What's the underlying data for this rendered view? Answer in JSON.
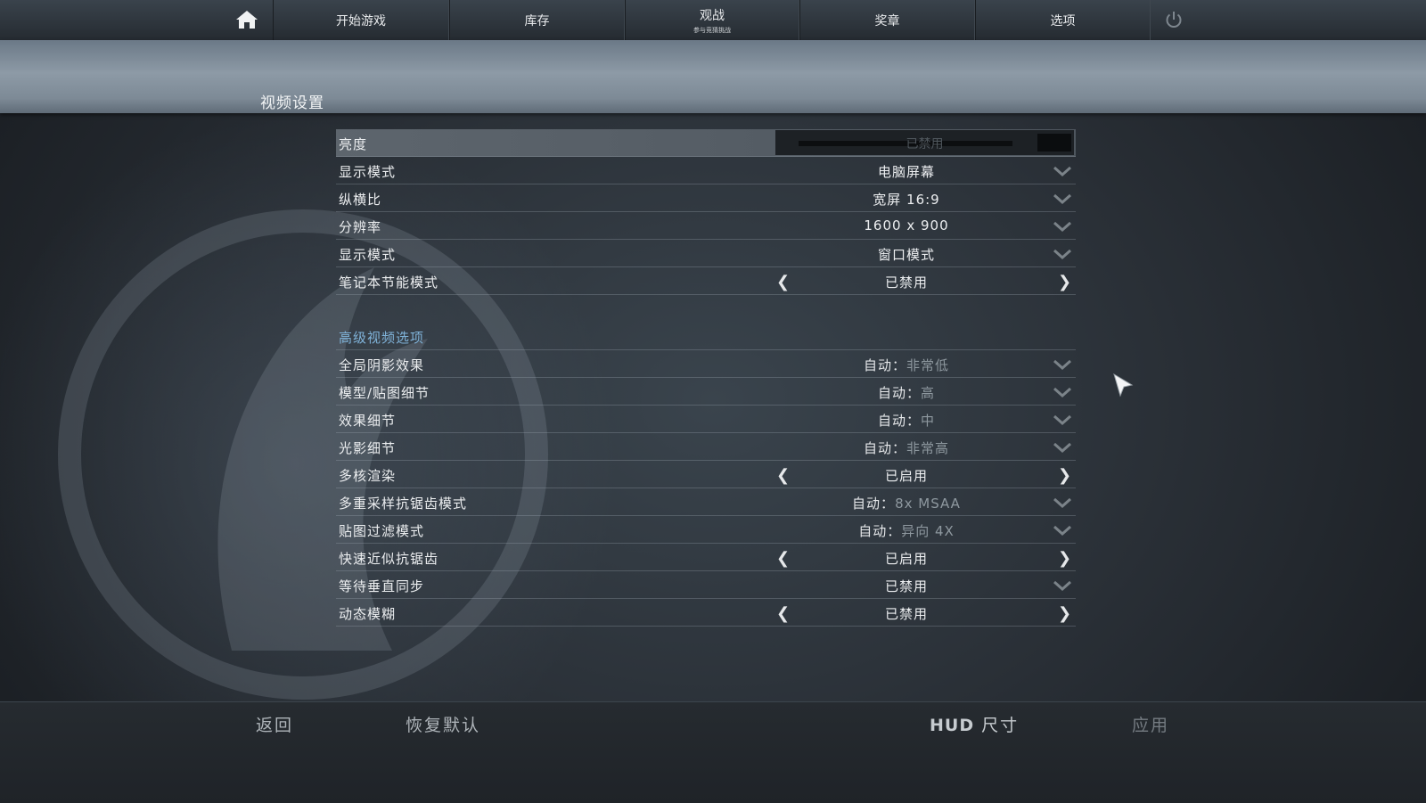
{
  "nav": {
    "items": [
      {
        "label": "开始游戏",
        "sub": ""
      },
      {
        "label": "库存",
        "sub": ""
      },
      {
        "label": "观战",
        "sub": "参与竞猜挑战"
      },
      {
        "label": "奖章",
        "sub": ""
      },
      {
        "label": "选项",
        "sub": ""
      }
    ],
    "home_icon": "home-icon",
    "power_icon": "power-icon"
  },
  "page": {
    "title": "视频设置"
  },
  "basic_settings": [
    {
      "label": "亮度",
      "control": "slider",
      "value": "已禁用"
    },
    {
      "label": "显示模式",
      "control": "dropdown",
      "value": "电脑屏幕"
    },
    {
      "label": "纵横比",
      "control": "dropdown",
      "value": "宽屏 16:9"
    },
    {
      "label": "分辨率",
      "control": "dropdown",
      "value": "1600 x 900"
    },
    {
      "label": "显示模式",
      "control": "dropdown",
      "value": "窗口模式"
    },
    {
      "label": "笔记本节能模式",
      "control": "toggle",
      "value": "已禁用"
    }
  ],
  "advanced": {
    "title": "高级视频选项",
    "settings": [
      {
        "label": "全局阴影效果",
        "control": "dropdown",
        "auto_prefix": "自动：",
        "value": "非常低"
      },
      {
        "label": "模型/贴图细节",
        "control": "dropdown",
        "auto_prefix": "自动：",
        "value": "高"
      },
      {
        "label": "效果细节",
        "control": "dropdown",
        "auto_prefix": "自动：",
        "value": "中"
      },
      {
        "label": "光影细节",
        "control": "dropdown",
        "auto_prefix": "自动：",
        "value": "非常高"
      },
      {
        "label": "多核渲染",
        "control": "toggle",
        "auto_prefix": "",
        "value": "已启用"
      },
      {
        "label": "多重采样抗锯齿模式",
        "control": "dropdown",
        "auto_prefix": "自动：",
        "value": "8x MSAA"
      },
      {
        "label": "贴图过滤模式",
        "control": "dropdown",
        "auto_prefix": "自动：",
        "value": "异向 4X"
      },
      {
        "label": "快速近似抗锯齿",
        "control": "toggle",
        "auto_prefix": "",
        "value": "已启用"
      },
      {
        "label": "等待垂直同步",
        "control": "dropdown",
        "auto_prefix": "",
        "value": "已禁用"
      },
      {
        "label": "动态模糊",
        "control": "toggle",
        "auto_prefix": "",
        "value": "已禁用"
      }
    ]
  },
  "bottom": {
    "back": "返回",
    "reset": "恢复默认",
    "hud_strong": "HUD",
    "hud_rest": "尺寸",
    "apply": "应用"
  },
  "colors": {
    "accent_section": "#7fb2d8",
    "auto_value": "#8e989f",
    "header_band": "#8d9aa6"
  }
}
